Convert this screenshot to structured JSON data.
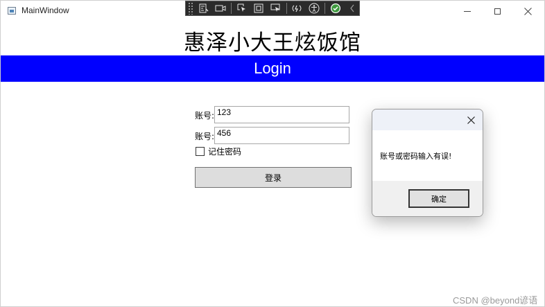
{
  "window": {
    "title": "MainWindow",
    "controls": [
      "minimize-icon",
      "maximize-icon",
      "close-icon"
    ]
  },
  "debug_toolbar": {
    "icons": [
      "grip-icon",
      "live-tree-icon",
      "camera-icon",
      "select-element-icon",
      "display-layout-adorners-icon",
      "track-focus-icon",
      "hot-reload-icon",
      "accessibility-icon",
      "check-icon",
      "collapse-chevron-icon"
    ]
  },
  "app": {
    "title": "惠泽小大王炫饭馆",
    "banner": "Login",
    "account_label": "账号:",
    "account_value": "123",
    "password_label": "账号:",
    "password_value": "456",
    "remember_label": "记住密码",
    "login_button": "登录",
    "banner_color": "#0000ff"
  },
  "dialog": {
    "message": "账号或密码输入有误!",
    "ok_button": "确定"
  },
  "watermark": "CSDN @beyond谚语"
}
